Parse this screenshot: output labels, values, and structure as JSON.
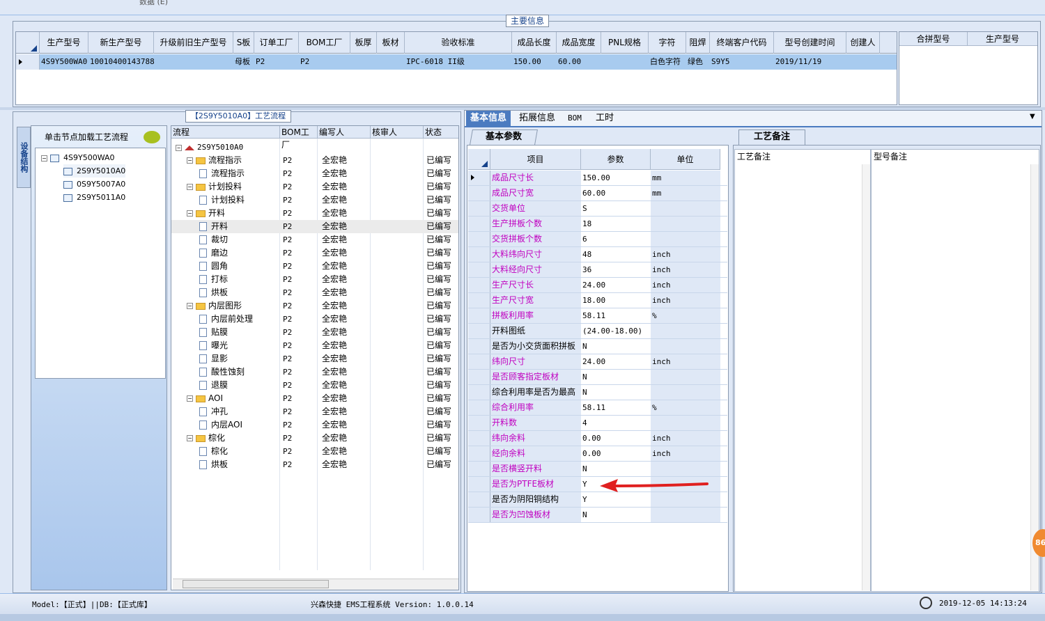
{
  "top_strip": {
    "text": "数据 (E)"
  },
  "main_info": {
    "title": "主要信息",
    "columns": [
      "生产型号",
      "新生产型号",
      "升级前旧生产型号",
      "S板",
      "订单工厂",
      "BOM工厂",
      "板厚",
      "板材",
      "验收标准",
      "成品长度",
      "成品宽度",
      "PNL规格",
      "字符",
      "阻焊",
      "终端客户代码",
      "型号创建时间",
      "创建人"
    ],
    "row": [
      "4S9Y500WA0",
      "10010400143788",
      "",
      "母板",
      "P2",
      "P2",
      "",
      "",
      "IPC-6018 II级",
      "150.00",
      "60.00",
      "",
      "白色字符",
      "绿色",
      "S9Y5",
      "2019/11/19",
      ""
    ],
    "merge_columns": [
      "合拼型号",
      "生产型号"
    ]
  },
  "left": {
    "flow_title": "【2S9Y5010A0】工艺流程",
    "vtab": "设备结构",
    "struct_head": "单击节点加载工艺流程",
    "struct_tree": [
      "4S9Y500WA0",
      "2S9Y5010A0",
      "0S9Y5007A0",
      "2S9Y5011A0"
    ],
    "flow_headers": [
      "流程",
      "BOM工厂",
      "编写人",
      "核审人",
      "状态"
    ],
    "flow_root": "2S9Y5010A0",
    "flow_rows": [
      {
        "name": "流程指示",
        "type": "folder",
        "bom": "P2",
        "writer": "全宏艳",
        "status": "已编写"
      },
      {
        "name": "流程指示",
        "type": "doc",
        "bom": "P2",
        "writer": "全宏艳",
        "status": "已编写"
      },
      {
        "name": "计划投料",
        "type": "folder",
        "bom": "P2",
        "writer": "全宏艳",
        "status": "已编写"
      },
      {
        "name": "计划投料",
        "type": "doc",
        "bom": "P2",
        "writer": "全宏艳",
        "status": "已编写"
      },
      {
        "name": "开料",
        "type": "folder",
        "bom": "P2",
        "writer": "全宏艳",
        "status": "已编写"
      },
      {
        "name": "开料",
        "type": "doc",
        "bom": "P2",
        "writer": "全宏艳",
        "status": "已编写",
        "selected": true
      },
      {
        "name": "裁切",
        "type": "doc",
        "bom": "P2",
        "writer": "全宏艳",
        "status": "已编写"
      },
      {
        "name": "磨边",
        "type": "doc",
        "bom": "P2",
        "writer": "全宏艳",
        "status": "已编写"
      },
      {
        "name": "圆角",
        "type": "doc",
        "bom": "P2",
        "writer": "全宏艳",
        "status": "已编写"
      },
      {
        "name": "打标",
        "type": "doc",
        "bom": "P2",
        "writer": "全宏艳",
        "status": "已编写"
      },
      {
        "name": "烘板",
        "type": "doc",
        "bom": "P2",
        "writer": "全宏艳",
        "status": "已编写"
      },
      {
        "name": "内层图形",
        "type": "folder",
        "bom": "P2",
        "writer": "全宏艳",
        "status": "已编写"
      },
      {
        "name": "内层前处理",
        "type": "doc",
        "bom": "P2",
        "writer": "全宏艳",
        "status": "已编写"
      },
      {
        "name": "贴膜",
        "type": "doc",
        "bom": "P2",
        "writer": "全宏艳",
        "status": "已编写"
      },
      {
        "name": "曝光",
        "type": "doc",
        "bom": "P2",
        "writer": "全宏艳",
        "status": "已编写"
      },
      {
        "name": "显影",
        "type": "doc",
        "bom": "P2",
        "writer": "全宏艳",
        "status": "已编写"
      },
      {
        "name": "酸性蚀刻",
        "type": "doc",
        "bom": "P2",
        "writer": "全宏艳",
        "status": "已编写"
      },
      {
        "name": "退膜",
        "type": "doc",
        "bom": "P2",
        "writer": "全宏艳",
        "status": "已编写"
      },
      {
        "name": "AOI",
        "type": "folder",
        "bom": "P2",
        "writer": "全宏艳",
        "status": "已编写"
      },
      {
        "name": "冲孔",
        "type": "doc",
        "bom": "P2",
        "writer": "全宏艳",
        "status": "已编写"
      },
      {
        "name": "内层AOI",
        "type": "doc",
        "bom": "P2",
        "writer": "全宏艳",
        "status": "已编写"
      },
      {
        "name": "棕化",
        "type": "folder",
        "bom": "P2",
        "writer": "全宏艳",
        "status": "已编写"
      },
      {
        "name": "棕化",
        "type": "doc",
        "bom": "P2",
        "writer": "全宏艳",
        "status": "已编写"
      },
      {
        "name": "烘板",
        "type": "doc",
        "bom": "P2",
        "writer": "全宏艳",
        "status": "已编写"
      }
    ]
  },
  "right": {
    "tabs": [
      "基本信息",
      "拓展信息",
      "BOM",
      "工时"
    ],
    "basic_tab": "基本参数",
    "param_headers": [
      "项目",
      "参数",
      "单位"
    ],
    "params": [
      {
        "name": "成品尺寸长",
        "value": "150.00",
        "unit": "mm",
        "pink": true
      },
      {
        "name": "成品尺寸宽",
        "value": "60.00",
        "unit": "mm",
        "pink": true
      },
      {
        "name": "交货单位",
        "value": "S",
        "unit": "",
        "pink": true
      },
      {
        "name": "生产拼板个数",
        "value": "18",
        "unit": "",
        "pink": true
      },
      {
        "name": "交货拼板个数",
        "value": "6",
        "unit": "",
        "pink": true
      },
      {
        "name": "大料纬向尺寸",
        "value": "48",
        "unit": "inch",
        "pink": true
      },
      {
        "name": "大料经向尺寸",
        "value": "36",
        "unit": "inch",
        "pink": true
      },
      {
        "name": "生产尺寸长",
        "value": "24.00",
        "unit": "inch",
        "pink": true
      },
      {
        "name": "生产尺寸宽",
        "value": "18.00",
        "unit": "inch",
        "pink": true
      },
      {
        "name": "拼板利用率",
        "value": "58.11",
        "unit": "%",
        "pink": true
      },
      {
        "name": "开料图纸",
        "value": "(24.00-18.00)",
        "unit": "",
        "pink": false
      },
      {
        "name": "是否为小交货面积拼板",
        "value": "N",
        "unit": "",
        "pink": false
      },
      {
        "name": "纬向尺寸",
        "value": "24.00",
        "unit": "inch",
        "pink": true
      },
      {
        "name": "是否顾客指定板材",
        "value": "N",
        "unit": "",
        "pink": true
      },
      {
        "name": "综合利用率是否为最高",
        "value": "N",
        "unit": "",
        "pink": false
      },
      {
        "name": "综合利用率",
        "value": "58.11",
        "unit": "%",
        "pink": true
      },
      {
        "name": "开料数",
        "value": "4",
        "unit": "",
        "pink": true
      },
      {
        "name": "纬向余料",
        "value": "0.00",
        "unit": "inch",
        "pink": true
      },
      {
        "name": "经向余料",
        "value": "0.00",
        "unit": "inch",
        "pink": true
      },
      {
        "name": "是否横竖开料",
        "value": "N",
        "unit": "",
        "pink": true
      },
      {
        "name": "是否为PTFE板材",
        "value": "Y",
        "unit": "",
        "pink": true
      },
      {
        "name": "是否为阴阳铜结构",
        "value": "Y",
        "unit": "",
        "pink": false
      },
      {
        "name": "是否为凹蚀板材",
        "value": "N",
        "unit": "",
        "pink": true
      }
    ],
    "notes_tab": "工艺备注",
    "notes_cols": [
      "工艺备注",
      "型号备注"
    ]
  },
  "status": {
    "model": "Model:【正式】||DB:【正式库】",
    "system": "兴森快捷 EMS工程系统 Version: 1.0.0.14",
    "time": "2019-12-05 14:13:24",
    "badge": "86"
  },
  "colors": {
    "selected_row": "#a8cbef",
    "accent": "#4b7bc0",
    "pink": "#c000c0",
    "arrow": "#e02020"
  }
}
